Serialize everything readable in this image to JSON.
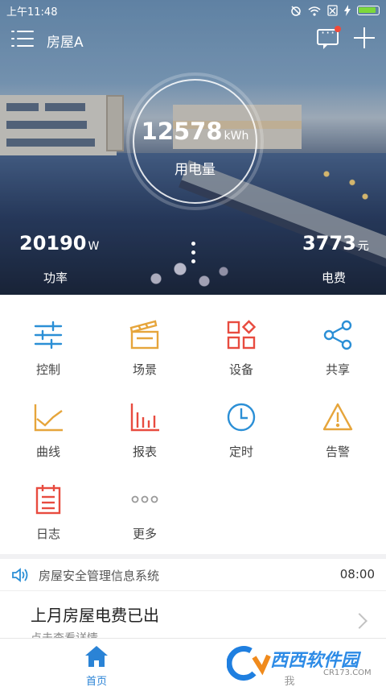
{
  "status_bar": {
    "time": "上午11:48"
  },
  "header": {
    "house_name": "房屋A"
  },
  "energy": {
    "value": "12578",
    "unit": "kWh",
    "label": "用电量"
  },
  "power": {
    "value": "20190",
    "unit": "W",
    "label": "功率"
  },
  "fee": {
    "value": "3773",
    "unit": "元",
    "label": "电费"
  },
  "grid": {
    "items": [
      {
        "label": "控制",
        "icon": "sliders-icon",
        "color": "#2b8fd6"
      },
      {
        "label": "场景",
        "icon": "clapperboard-icon",
        "color": "#e6a53b"
      },
      {
        "label": "设备",
        "icon": "device-grid-icon",
        "color": "#e84b3f"
      },
      {
        "label": "共享",
        "icon": "share-icon",
        "color": "#2b8fd6"
      },
      {
        "label": "曲线",
        "icon": "line-chart-icon",
        "color": "#e6a53b"
      },
      {
        "label": "报表",
        "icon": "bar-chart-icon",
        "color": "#e84b3f"
      },
      {
        "label": "定时",
        "icon": "clock-icon",
        "color": "#2b8fd6"
      },
      {
        "label": "告警",
        "icon": "warning-icon",
        "color": "#e6a53b"
      },
      {
        "label": "日志",
        "icon": "log-icon",
        "color": "#e84b3f"
      },
      {
        "label": "更多",
        "icon": "more-icon",
        "color": "#999999"
      }
    ]
  },
  "notice": {
    "text": "房屋安全管理信息系统",
    "time": "08:00"
  },
  "bill": {
    "title": "上月房屋电费已出",
    "subtitle": "点击查看详情"
  },
  "nav": {
    "home": "首页",
    "me": "我"
  },
  "watermark": {
    "brand": "西西软件园",
    "sub": "CR173.COM"
  }
}
